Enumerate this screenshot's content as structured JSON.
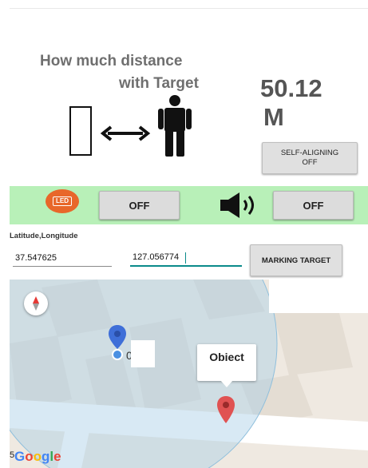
{
  "distance_panel": {
    "title_line1": "How much distance",
    "title_line2": "with Target",
    "distance_value": "50.12",
    "distance_unit": "M",
    "self_aligning_line1": "SELF-ALIGNING",
    "self_aligning_line2": "OFF"
  },
  "controls": {
    "led_badge": "LED",
    "led_button": "OFF",
    "sound_button": "OFF",
    "accent_color": "#e8672a",
    "bar_color": "#b8f0b8"
  },
  "coordinates": {
    "label": "Latitude,Longitude",
    "latitude": "37.547625",
    "longitude": "127.056774",
    "marking_button": "MARKING TARGET"
  },
  "map": {
    "user_label": "0",
    "object_label": "Obiect",
    "scale_mark": "5",
    "logo": [
      {
        "char": "G",
        "color": "#4285f4"
      },
      {
        "char": "o",
        "color": "#ea4335"
      },
      {
        "char": "o",
        "color": "#fbbc05"
      },
      {
        "char": "g",
        "color": "#4285f4"
      },
      {
        "char": "l",
        "color": "#34a853"
      },
      {
        "char": "e",
        "color": "#ea4335"
      }
    ]
  }
}
